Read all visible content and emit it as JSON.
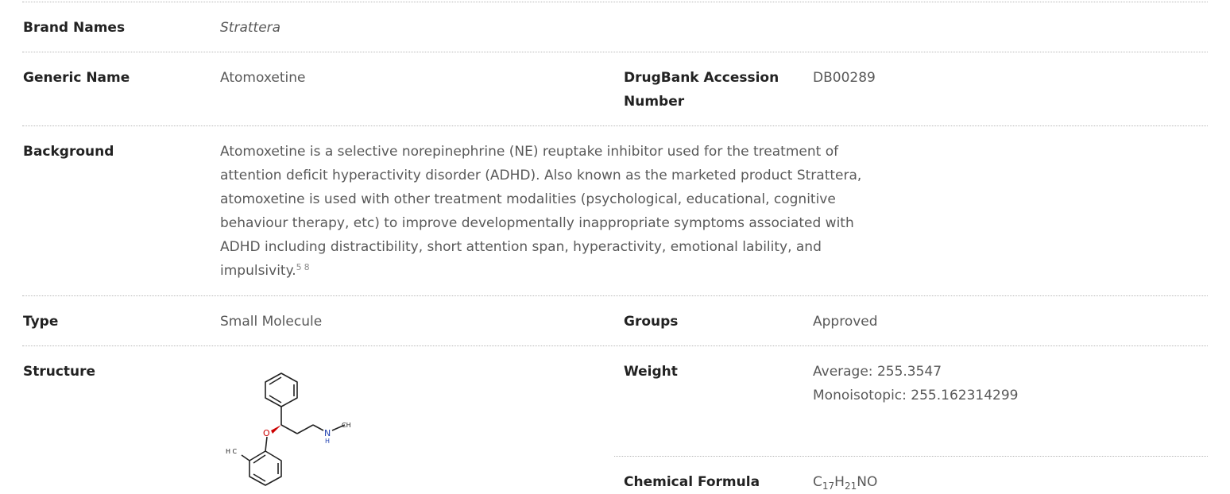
{
  "brand_names": {
    "label": "Brand Names",
    "value": "Strattera"
  },
  "generic_name": {
    "label": "Generic Name",
    "value": "Atomoxetine"
  },
  "accession": {
    "label_line1": "DrugBank Accession",
    "label_line2": "Number",
    "value": "DB00289"
  },
  "background": {
    "label": "Background",
    "lines": [
      "Atomoxetine is a selective norepinephrine (NE) reuptake inhibitor used for the treatment of",
      "attention deficit hyperactivity disorder (ADHD). Also known as the marketed product Strattera,",
      "atomoxetine is used with other treatment modalities (psychological, educational, cognitive",
      "behaviour therapy, etc) to improve developmentally inappropriate symptoms associated with",
      "ADHD including distractibility, short attention span, hyperactivity, emotional lability, and",
      "impulsivity."
    ],
    "refs": [
      "5",
      "8"
    ]
  },
  "type": {
    "label": "Type",
    "value": "Small Molecule"
  },
  "groups": {
    "label": "Groups",
    "value": "Approved"
  },
  "structure": {
    "label": "Structure",
    "atom_o": "O",
    "atom_n": "N",
    "atom_h": "H",
    "atom_ch3": "CH",
    "atom_h3c": "H C",
    "icon": "molecule-structure-image"
  },
  "weight": {
    "label": "Weight",
    "average": "Average: 255.3547",
    "monoisotopic": "Monoisotopic: 255.162314299"
  },
  "formula": {
    "label": "Chemical Formula",
    "parts": [
      {
        "text": "C",
        "sub": "17"
      },
      {
        "text": "H",
        "sub": "21"
      },
      {
        "text": "NO",
        "sub": ""
      }
    ]
  },
  "colors": {
    "label": "#222222",
    "value": "#595959",
    "rule": "#b8b8b8",
    "oxygen": "#cc0000",
    "nitrogen": "#1f3fb0"
  }
}
